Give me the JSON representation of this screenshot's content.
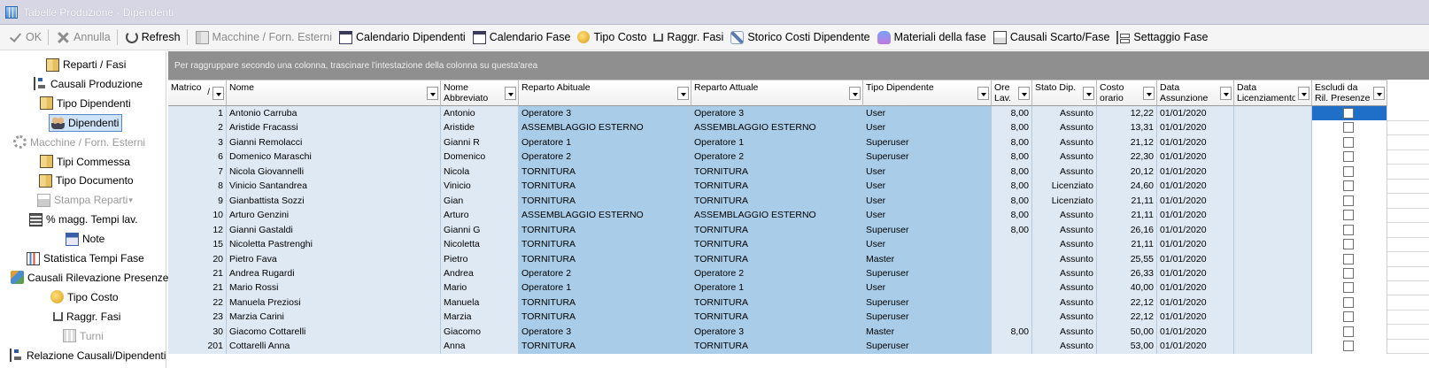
{
  "window": {
    "title": "Tabelle Produzione - Dipendenti"
  },
  "toolbar": {
    "buttons": [
      {
        "label": "OK",
        "icon": "check-icon",
        "enabled": false
      },
      {
        "label": "Annulla",
        "icon": "close-icon",
        "enabled": false
      },
      {
        "label": "Refresh",
        "icon": "refresh-icon",
        "enabled": true
      },
      {
        "label": "Macchine / Forn. Esterni",
        "icon": "machine-icon",
        "enabled": false
      },
      {
        "label": "Calendario Dipendenti",
        "icon": "calendar-icon",
        "enabled": true
      },
      {
        "label": "Calendario Fase",
        "icon": "calendar-icon",
        "enabled": true
      },
      {
        "label": "Tipo Costo",
        "icon": "coin-icon",
        "enabled": true
      },
      {
        "label": "Raggr. Fasi",
        "icon": "fork-icon",
        "enabled": true
      },
      {
        "label": "Storico Costi Dipendente",
        "icon": "wrench-icon",
        "enabled": true
      },
      {
        "label": "Materiali della fase",
        "icon": "pot-icon",
        "enabled": true
      },
      {
        "label": "Causali Scarto/Fase",
        "icon": "box-icon",
        "enabled": true
      },
      {
        "label": "Settaggio Fase",
        "icon": "tree-icon",
        "enabled": true
      }
    ]
  },
  "sidebar": {
    "items": [
      {
        "label": "Reparti / Fasi",
        "icon": "book-icon",
        "enabled": true
      },
      {
        "label": "Causali Produzione",
        "icon": "tree-icon",
        "enabled": true
      },
      {
        "label": "Tipo Dipendenti",
        "icon": "book-icon",
        "enabled": true
      },
      {
        "label": "Dipendenti",
        "icon": "people-icon",
        "enabled": true,
        "active": true
      },
      {
        "label": "Macchine / Forn. Esterni",
        "icon": "machine-icon",
        "enabled": false
      },
      {
        "label": "Tipi Commessa",
        "icon": "book-icon",
        "enabled": true
      },
      {
        "label": "Tipo Documento",
        "icon": "book-icon",
        "enabled": true
      },
      {
        "label": "Stampa Reparti",
        "icon": "print-icon",
        "enabled": false,
        "dropdown": true
      },
      {
        "label": "% magg. Tempi lav.",
        "icon": "calculator-icon",
        "enabled": true
      },
      {
        "label": "Note",
        "icon": "note-icon",
        "enabled": true
      },
      {
        "label": "Statistica Tempi Fase",
        "icon": "chart-icon",
        "enabled": true
      },
      {
        "label": "Causali Rilevazione Presenze",
        "icon": "cube-icon",
        "enabled": true
      },
      {
        "label": "Tipo Costo",
        "icon": "coin-icon",
        "enabled": true
      },
      {
        "label": "Raggr. Fasi",
        "icon": "fork-icon",
        "enabled": true
      },
      {
        "label": "Turni",
        "icon": "grid-icon",
        "enabled": false
      },
      {
        "label": "Relazione Causali/Dipendenti",
        "icon": "tree-icon",
        "enabled": true
      }
    ]
  },
  "grid": {
    "group_hint": "Per raggruppare secondo una colonna, trascinare l'intestazione della colonna su questa'area",
    "columns": [
      {
        "key": "matricola",
        "label": "Matrico",
        "sort": "/"
      },
      {
        "key": "nome",
        "label": "Nome"
      },
      {
        "key": "nome_abbr",
        "label": "Nome Abbreviato"
      },
      {
        "key": "rep_abituale",
        "label": "Reparto Abituale"
      },
      {
        "key": "rep_attuale",
        "label": "Reparto Attuale"
      },
      {
        "key": "tipo_dip",
        "label": "Tipo Dipendente"
      },
      {
        "key": "ore_lav",
        "label": "Ore Lav."
      },
      {
        "key": "stato_dip",
        "label": "Stato Dip."
      },
      {
        "key": "costo_orario",
        "label": "Costo orario"
      },
      {
        "key": "data_assunzione",
        "label": "Data Assunzione"
      },
      {
        "key": "data_licenziamento",
        "label": "Data Licenziamento"
      },
      {
        "key": "escludi",
        "label": "Escludi da Ril. Presenze"
      }
    ],
    "rows": [
      [
        "1",
        "Antonio Carruba",
        "Antonio",
        "Operatore 3",
        "Operatore 3",
        "User",
        "8,00",
        "Assunto",
        "12,22",
        "01/01/2020",
        "",
        false
      ],
      [
        "2",
        "Aristide Fracassi",
        "Aristide",
        "ASSEMBLAGGIO ESTERNO",
        "ASSEMBLAGGIO ESTERNO",
        "User",
        "8,00",
        "Assunto",
        "13,31",
        "01/01/2020",
        "",
        false
      ],
      [
        "3",
        "Gianni Remolacci",
        "Gianni R",
        "Operatore 1",
        "Operatore 1",
        "Superuser",
        "8,00",
        "Assunto",
        "21,12",
        "01/01/2020",
        "",
        false
      ],
      [
        "6",
        "Domenico Maraschi",
        "Domenico",
        "Operatore 2",
        "Operatore 2",
        "Superuser",
        "8,00",
        "Assunto",
        "22,30",
        "01/01/2020",
        "",
        false
      ],
      [
        "7",
        "Nicola Giovannelli",
        "Nicola",
        "TORNITURA",
        "TORNITURA",
        "User",
        "8,00",
        "Assunto",
        "20,12",
        "01/01/2020",
        "",
        false
      ],
      [
        "8",
        "Vinicio Santandrea",
        "Vinicio",
        "TORNITURA",
        "TORNITURA",
        "User",
        "8,00",
        "Licenziato",
        "24,60",
        "01/01/2020",
        "",
        false
      ],
      [
        "9",
        "Gianbattista Sozzi",
        "Gian",
        "TORNITURA",
        "TORNITURA",
        "User",
        "8,00",
        "Licenziato",
        "21,11",
        "01/01/2020",
        "",
        false
      ],
      [
        "10",
        "Arturo Genzini",
        "Arturo",
        "ASSEMBLAGGIO ESTERNO",
        "ASSEMBLAGGIO ESTERNO",
        "User",
        "8,00",
        "Assunto",
        "21,11",
        "01/01/2020",
        "",
        false
      ],
      [
        "12",
        "Gianni Gastaldi",
        "Gianni G",
        "TORNITURA",
        "TORNITURA",
        "Superuser",
        "8,00",
        "Assunto",
        "26,16",
        "01/01/2020",
        "",
        false
      ],
      [
        "15",
        "Nicoletta Pastrenghi",
        "Nicoletta",
        "TORNITURA",
        "TORNITURA",
        "User",
        "",
        "Assunto",
        "21,11",
        "01/01/2020",
        "",
        false
      ],
      [
        "20",
        "Pietro Fava",
        "Pietro",
        "TORNITURA",
        "TORNITURA",
        "Master",
        "",
        "Assunto",
        "25,55",
        "01/01/2020",
        "",
        false
      ],
      [
        "21",
        "Andrea Rugardi",
        "Andrea",
        "Operatore 2",
        "Operatore 2",
        "Superuser",
        "",
        "Assunto",
        "26,33",
        "01/01/2020",
        "",
        false
      ],
      [
        "21",
        "Mario Rossi",
        "Mario",
        "Operatore 1",
        "Operatore 1",
        "User",
        "",
        "Assunto",
        "40,00",
        "01/01/2020",
        "",
        false
      ],
      [
        "22",
        "Manuela Preziosi",
        "Manuela",
        "TORNITURA",
        "TORNITURA",
        "Superuser",
        "",
        "Assunto",
        "22,12",
        "01/01/2020",
        "",
        false
      ],
      [
        "23",
        "Marzia Carini",
        "Marzia",
        "TORNITURA",
        "TORNITURA",
        "Superuser",
        "",
        "Assunto",
        "22,12",
        "01/01/2020",
        "",
        false
      ],
      [
        "30",
        "Giacomo Cottarelli",
        "Giacomo",
        "Operatore 3",
        "Operatore 3",
        "Master",
        "8,00",
        "Assunto",
        "50,00",
        "01/01/2020",
        "",
        false
      ],
      [
        "201",
        "Cottarelli Anna",
        "Anna",
        "TORNITURA",
        "TORNITURA",
        "Superuser",
        "",
        "Assunto",
        "53,00",
        "01/01/2020",
        "",
        false
      ]
    ]
  },
  "colors": {
    "accent": "#1f6fc9",
    "row_bg": "#dfe9f4",
    "selected_bg": "#a9cde9",
    "groupbar": "#8f8f8f"
  }
}
